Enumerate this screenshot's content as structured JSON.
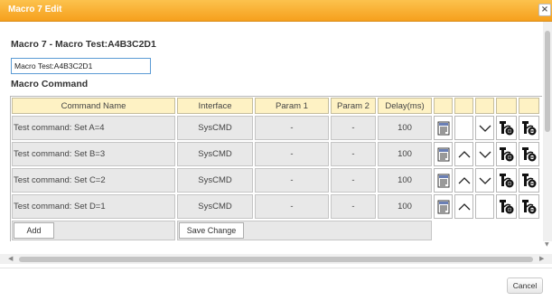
{
  "dialog": {
    "title": "Macro 7 Edit",
    "close_icon": "close-icon"
  },
  "macro": {
    "heading": "Macro 7 - Macro Test:A4B3C2D1",
    "name_value": "Macro Test:A4B3C2D1",
    "section_label": "Macro Command"
  },
  "table": {
    "headers": {
      "command_name": "Command Name",
      "interface": "Interface",
      "param1": "Param 1",
      "param2": "Param 2",
      "delay": "Delay(ms)"
    },
    "rows": [
      {
        "command_name": "Test command: Set A=4",
        "interface": "SysCMD",
        "param1": "-",
        "param2": "-",
        "delay": "100",
        "has_up": false,
        "has_down": true
      },
      {
        "command_name": "Test command: Set B=3",
        "interface": "SysCMD",
        "param1": "-",
        "param2": "-",
        "delay": "100",
        "has_up": true,
        "has_down": true
      },
      {
        "command_name": "Test command: Set C=2",
        "interface": "SysCMD",
        "param1": "-",
        "param2": "-",
        "delay": "100",
        "has_up": true,
        "has_down": true
      },
      {
        "command_name": "Test command: Set D=1",
        "interface": "SysCMD",
        "param1": "-",
        "param2": "-",
        "delay": "100",
        "has_up": true,
        "has_down": false
      }
    ],
    "row_action_icons": [
      "edit-list-icon",
      "move-up-icon",
      "move-down-icon",
      "insert-command-icon",
      "delete-command-icon"
    ],
    "add_label": "Add",
    "save_label": "Save Change"
  },
  "footer": {
    "cancel_label": "Cancel"
  },
  "colors": {
    "titlebar": "#f6a01d",
    "header_bg": "#fef2c4",
    "cell_bg": "#e8e8e8",
    "input_border": "#5b9bd5"
  }
}
